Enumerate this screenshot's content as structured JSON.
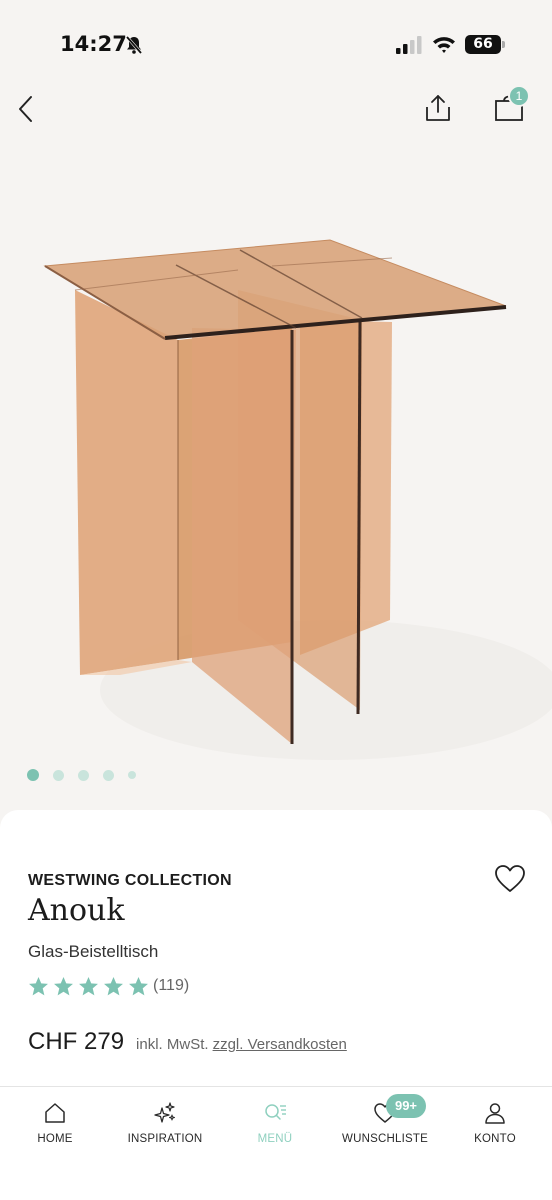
{
  "status_bar": {
    "time": "14:27",
    "battery": "66",
    "icons": [
      "bell-muted-icon",
      "cellular-signal-icon",
      "wifi-icon",
      "battery-icon"
    ]
  },
  "top_nav": {
    "icons": [
      "back-chevron-icon",
      "share-icon",
      "cart-icon"
    ],
    "cart_count": "1"
  },
  "gallery": {
    "image_count": 5,
    "active_index": 0,
    "image_icon": "glass-side-table-image"
  },
  "product": {
    "brand": "WESTWING COLLECTION",
    "name": "Anouk",
    "subtitle": "Glas-Beistelltisch",
    "rating": 5,
    "rating_max": 5,
    "rating_count": "(119)",
    "price": "CHF 279",
    "tax_note": "inkl. MwSt.",
    "shipping_link": "zzgl. Versandkosten",
    "wishlist_icon": "heart-outline-icon"
  },
  "bottom_nav": {
    "items": [
      {
        "label": "HOME",
        "icon": "home-icon"
      },
      {
        "label": "INSPIRATION",
        "icon": "sparkles-icon"
      },
      {
        "label": "MENÜ",
        "icon": "search-menu-icon"
      },
      {
        "label": "WUNSCHLISTE",
        "icon": "heart-icon"
      },
      {
        "label": "KONTO",
        "icon": "user-icon"
      }
    ],
    "active_item": "MENÜ",
    "wishlist_badge": "99+"
  },
  "colors": {
    "accent": "#7cc2b1",
    "accent_light": "#c9e4dc",
    "background": "#f6f4f2",
    "text": "#1c1c1c"
  }
}
